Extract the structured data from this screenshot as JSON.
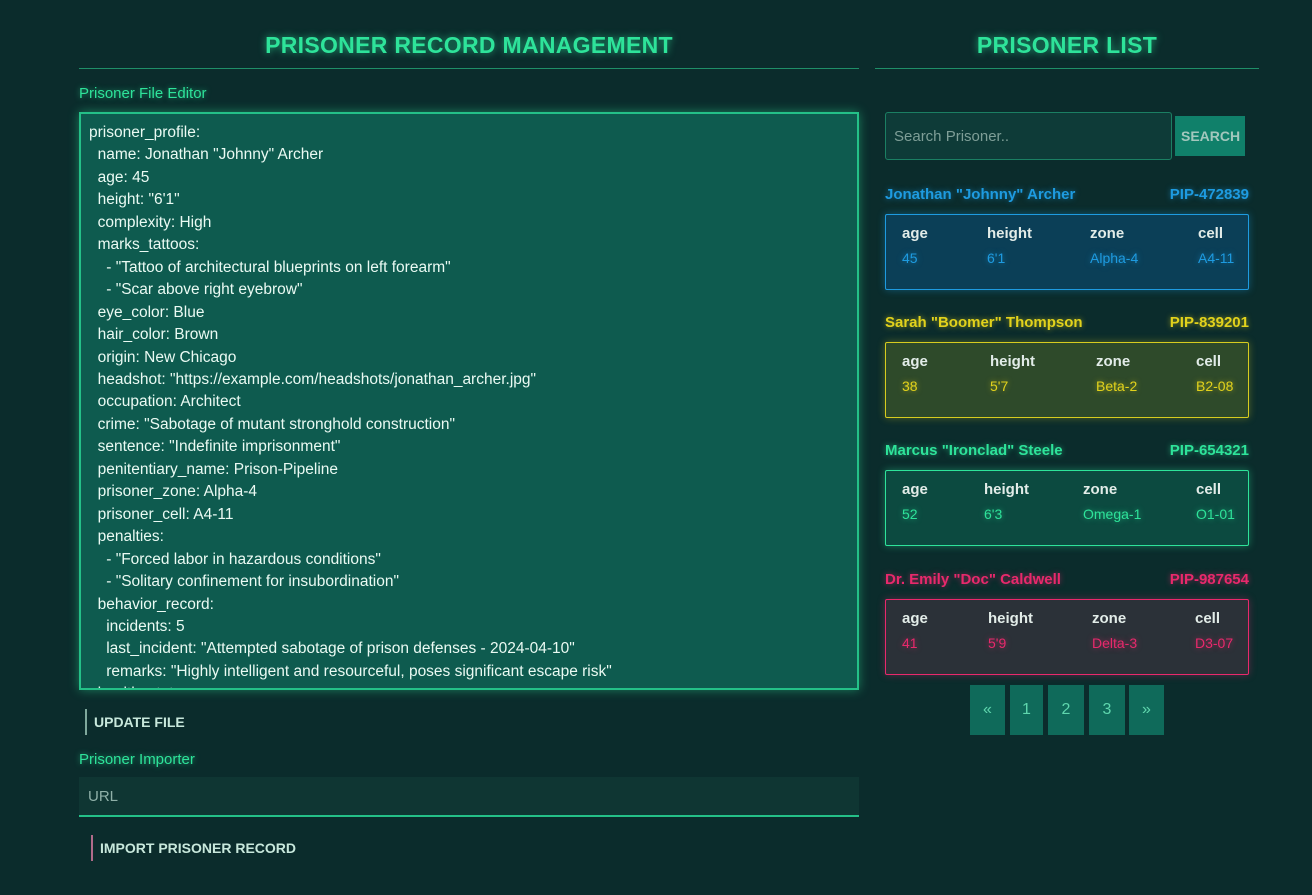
{
  "editor_panel": {
    "title": "PRISONER RECORD MANAGEMENT",
    "editor_label": "Prisoner File Editor",
    "file_content": "prisoner_profile:\n  name: Jonathan \"Johnny\" Archer\n  age: 45\n  height: \"6'1\"\n  complexity: High\n  marks_tattoos:\n    - \"Tattoo of architectural blueprints on left forearm\"\n    - \"Scar above right eyebrow\"\n  eye_color: Blue\n  hair_color: Brown\n  origin: New Chicago\n  headshot: \"https://example.com/headshots/jonathan_archer.jpg\"\n  occupation: Architect\n  crime: \"Sabotage of mutant stronghold construction\"\n  sentence: \"Indefinite imprisonment\"\n  penitentiary_name: Prison-Pipeline\n  prisoner_zone: Alpha-4\n  prisoner_cell: A4-11\n  penalties:\n    - \"Forced labor in hazardous conditions\"\n    - \"Solitary confinement for insubordination\"\n  behavior_record:\n    incidents: 5\n    last_incident: \"Attempted sabotage of prison defenses - 2024-04-10\"\n    remarks: \"Highly intelligent and resourceful, poses significant escape risk\"\n  health_status:",
    "update_button": "UPDATE FILE",
    "importer_label": "Prisoner Importer",
    "url_placeholder": "URL",
    "import_button": "IMPORT PRISONER RECORD"
  },
  "list_panel": {
    "title": "PRISONER LIST",
    "search_placeholder": "Search Prisoner..",
    "search_button": "SEARCH",
    "stat_labels": {
      "age": "age",
      "height": "height",
      "zone": "zone",
      "cell": "cell"
    },
    "prisoners": [
      {
        "name": "Jonathan \"Johnny\" Archer",
        "id": "PIP-472839",
        "age": "45",
        "height": "6'1",
        "zone": "Alpha-4",
        "cell": "A4-11",
        "color": "#1e9be0"
      },
      {
        "name": "Sarah \"Boomer\" Thompson",
        "id": "PIP-839201",
        "age": "38",
        "height": "5'7",
        "zone": "Beta-2",
        "cell": "B2-08",
        "color": "#e2d21c"
      },
      {
        "name": "Marcus \"Ironclad\" Steele",
        "id": "PIP-654321",
        "age": "52",
        "height": "6'3",
        "zone": "Omega-1",
        "cell": "O1-01",
        "color": "#2ee39a"
      },
      {
        "name": "Dr. Emily \"Doc\" Caldwell",
        "id": "PIP-987654",
        "age": "41",
        "height": "5'9",
        "zone": "Delta-3",
        "cell": "D3-07",
        "color": "#e8296c"
      }
    ],
    "pagination": {
      "prev": "«",
      "pages": [
        "1",
        "2",
        "3"
      ],
      "next": "»"
    }
  }
}
